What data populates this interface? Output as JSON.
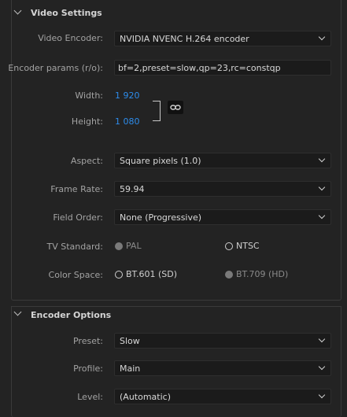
{
  "video_settings": {
    "title": "Video Settings",
    "video_encoder": {
      "label": "Video Encoder:",
      "value": "NVIDIA NVENC H.264 encoder"
    },
    "encoder_params": {
      "label": "Encoder params (r/o):",
      "value": "bf=2,preset=slow,qp=23,rc=constqp"
    },
    "width": {
      "label": "Width:",
      "value": "1 920"
    },
    "height": {
      "label": "Height:",
      "value": "1 080"
    },
    "aspect": {
      "label": "Aspect:",
      "value": "Square pixels (1.0)"
    },
    "frame_rate": {
      "label": "Frame Rate:",
      "value": "59.94"
    },
    "field_order": {
      "label": "Field Order:",
      "value": "None (Progressive)"
    },
    "tv_standard": {
      "label": "TV Standard:",
      "options": [
        "PAL",
        "NTSC"
      ]
    },
    "color_space": {
      "label": "Color Space:",
      "options": [
        "BT.601 (SD)",
        "BT.709 (HD)"
      ]
    }
  },
  "encoder_options": {
    "title": "Encoder Options",
    "preset": {
      "label": "Preset:",
      "value": "Slow"
    },
    "profile": {
      "label": "Profile:",
      "value": "Main"
    },
    "level": {
      "label": "Level:",
      "value": "(Automatic)"
    }
  },
  "colors": {
    "accent": "#2d8ceb",
    "background": "#232323",
    "field_bg": "#1b1b1b"
  }
}
